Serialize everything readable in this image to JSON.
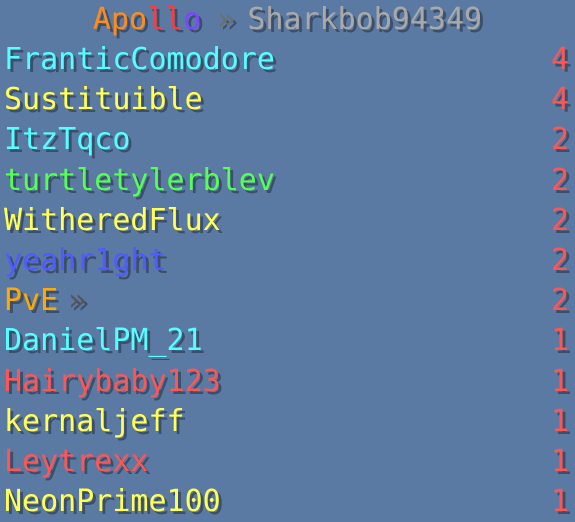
{
  "header": {
    "title_letters": [
      {
        "char": "A",
        "color": "#ff8c1a"
      },
      {
        "char": "p",
        "color": "#ff8c1a"
      },
      {
        "char": "o",
        "color": "#ff8c1a"
      },
      {
        "char": "l",
        "color": "#ff3a3a"
      },
      {
        "char": "l",
        "color": "#ff3a3a"
      },
      {
        "char": "o",
        "color": "#7a47ff"
      }
    ],
    "separator": "»",
    "player_name": "Sharkbob94349"
  },
  "rows": [
    {
      "name": "FranticComodore",
      "score": "4",
      "color": "#55ffff",
      "suffix": ""
    },
    {
      "name": "Sustituible",
      "score": "4",
      "color": "#ffff55",
      "suffix": ""
    },
    {
      "name": "ItzTqco",
      "score": "2",
      "color": "#55ffff",
      "suffix": ""
    },
    {
      "name": "turtletylerblev",
      "score": "2",
      "color": "#55ff55",
      "suffix": ""
    },
    {
      "name": "WitheredFlux",
      "score": "2",
      "color": "#ffff55",
      "suffix": ""
    },
    {
      "name": "yeahr1ght",
      "score": "2",
      "color": "#4f5bff",
      "suffix": ""
    },
    {
      "name": "PvE",
      "score": "2",
      "color": "#ffaa00",
      "suffix": "»"
    },
    {
      "name": "DanielPM_21",
      "score": "1",
      "color": "#55ffff",
      "suffix": ""
    },
    {
      "name": "Hairybaby123",
      "score": "1",
      "color": "#ff5555",
      "suffix": ""
    },
    {
      "name": "kernaljeff",
      "score": "1",
      "color": "#ffff55",
      "suffix": ""
    },
    {
      "name": "Leytrexx",
      "score": "1",
      "color": "#ff5555",
      "suffix": ""
    },
    {
      "name": "NeonPrime100",
      "score": "1",
      "color": "#ffff55",
      "suffix": ""
    }
  ]
}
